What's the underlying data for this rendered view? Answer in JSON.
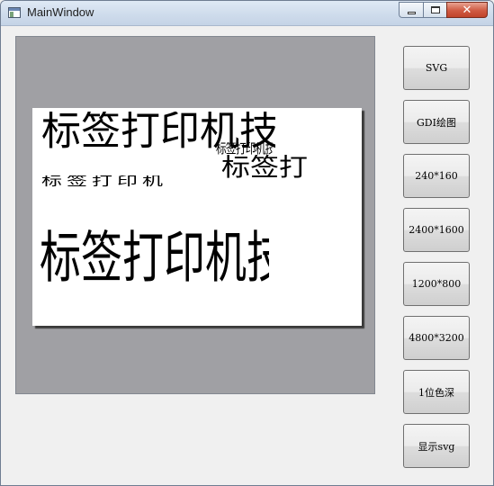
{
  "window": {
    "title": "MainWindow",
    "caption_buttons": {
      "minimize": "minimize",
      "maximize": "maximize",
      "close": "close"
    }
  },
  "canvas": {
    "labels": [
      "标签打印机技",
      "标签打印机技",
      "标签打",
      "标签打印机",
      "标签打印机技"
    ]
  },
  "buttons": {
    "svg": "SVG",
    "gdi": "GDI绘图",
    "r240": "240*160",
    "r2400": "2400*1600",
    "r1200": "1200*800",
    "r4800": "4800*3200",
    "onebit": "1位色深",
    "show_svg": "显示svg"
  }
}
